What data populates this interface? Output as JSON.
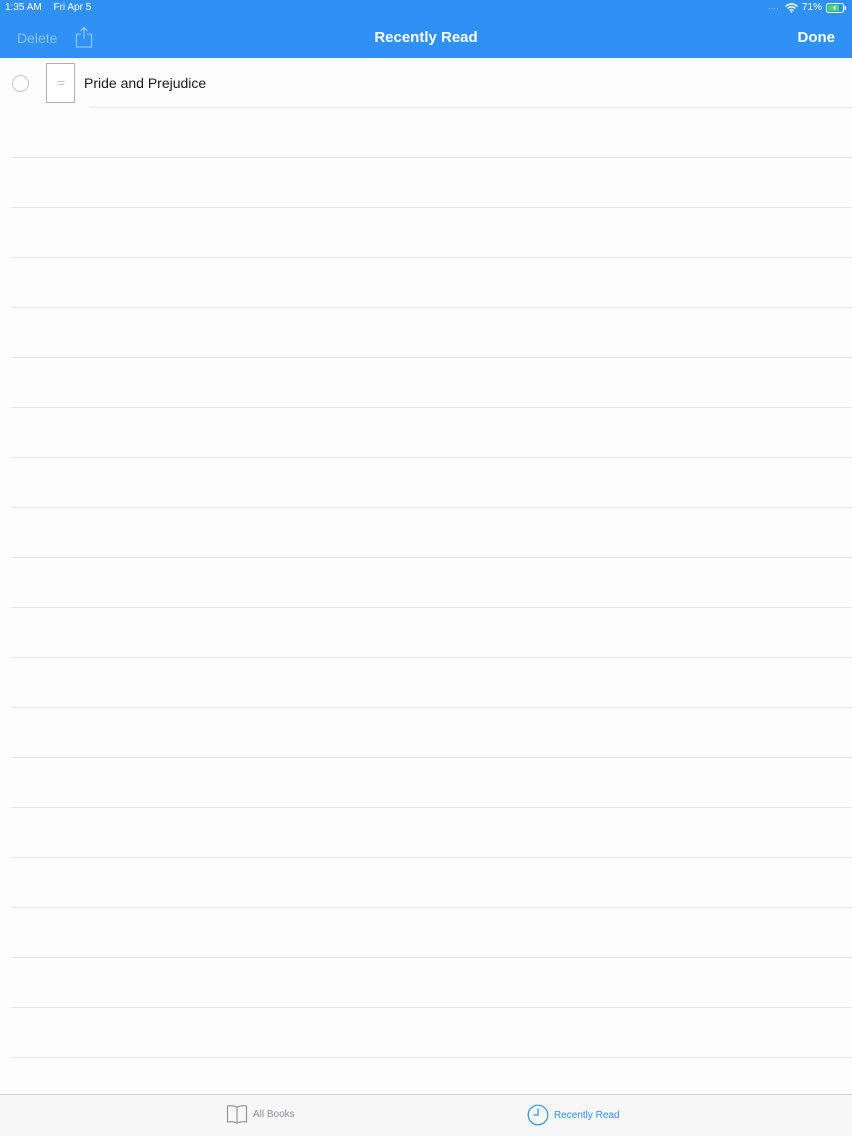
{
  "status_bar": {
    "time": "1:35 AM",
    "date": "Fri Apr 5",
    "signal": "....",
    "battery": "71%"
  },
  "nav": {
    "delete_label": "Delete",
    "title": "Recently Read",
    "done_label": "Done"
  },
  "books": [
    {
      "title": "Pride and Prejudice"
    }
  ],
  "tabs": [
    {
      "label": "All Books",
      "icon": "book-icon",
      "selected": false
    },
    {
      "label": "Recently Read",
      "icon": "clock-icon",
      "selected": true
    }
  ],
  "colors": {
    "accent": "#2f90f6",
    "tab_inactive": "#8e8e93",
    "separator": "#e4e4e4"
  }
}
